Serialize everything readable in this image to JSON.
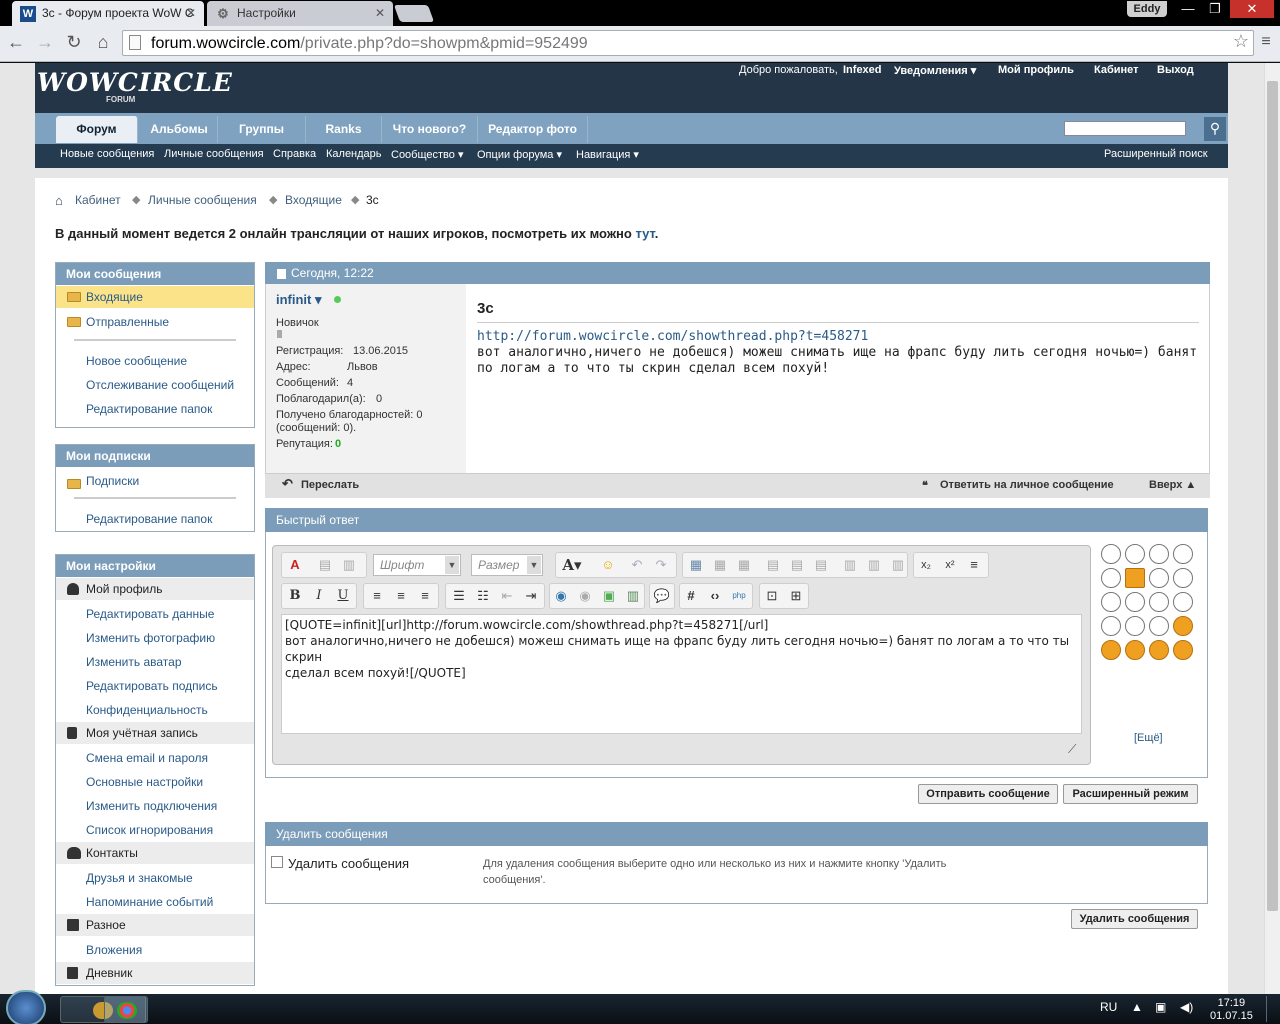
{
  "browser": {
    "tabs": [
      {
        "title": "3с - Форум проекта WoW C",
        "icon": "wowcircle-favicon"
      },
      {
        "title": "Настройки",
        "icon": "gear-icon"
      }
    ],
    "user": "Eddy",
    "url_host": "forum.wowcircle.com",
    "url_path": "/private.php?do=showpm&pmid=952499"
  },
  "site": {
    "logo": "WOWCIRCLE",
    "logo_sub": "FORUM",
    "top_links": [
      "Добро пожаловать,",
      "Infexed",
      "Уведомления",
      "Мой профиль",
      "Кабинет",
      "Выход"
    ],
    "tabs": [
      "Форум",
      "Альбомы",
      "Группы",
      "Ranks",
      "Что нового?",
      "Редактор фото"
    ],
    "subnav": [
      "Новые сообщения",
      "Личные сообщения",
      "Справка",
      "Календарь",
      "Сообщество",
      "Опции форума",
      "Навигация"
    ],
    "advanced_search": "Расширенный поиск"
  },
  "breadcrumb": [
    "Кабинет",
    "Личные сообщения",
    "Входящие",
    "3с"
  ],
  "notice": {
    "text": "В данный момент ведется 2 онлайн трансляции от наших игроков, посмотреть их можно ",
    "link": "тут",
    "end": "."
  },
  "sidebar": {
    "messages": {
      "title": "Мои сообщения",
      "folders": [
        "Входящие",
        "Отправленные"
      ],
      "links": [
        "Новое сообщение",
        "Отслеживание сообщений",
        "Редактирование папок"
      ]
    },
    "subscriptions": {
      "title": "Мои подписки",
      "folders": [
        "Подписки"
      ],
      "links": [
        "Редактирование папок"
      ]
    },
    "settings": {
      "title": "Мои настройки",
      "profile": "Мой профиль",
      "profile_links": [
        "Редактировать данные",
        "Изменить фотографию",
        "Изменить аватар",
        "Редактировать подпись",
        "Конфиденциальность"
      ],
      "account": "Моя учётная запись",
      "account_links": [
        "Смена email и пароля",
        "Основные настройки",
        "Изменить подключения",
        "Список игнорирования"
      ],
      "contacts": "Контакты",
      "contacts_links": [
        "Друзья и знакомые",
        "Напоминание событий"
      ],
      "misc": "Разное",
      "misc_links": [
        "Вложения"
      ],
      "diary": "Дневник"
    }
  },
  "pm": {
    "date": "Сегодня, 12:22",
    "author": "infinit",
    "rank": "Новичок",
    "registration_label": "Регистрация:",
    "registration": "13.06.2015",
    "address_label": "Адрес:",
    "address": "Львов",
    "posts_label": "Сообщений:",
    "posts": "4",
    "thanked_label": "Поблагодарил(а):",
    "thanked": "0",
    "thanks_received": "Получено благодарностей: 0",
    "thanks_received2": "(сообщений: 0).",
    "reputation_label": "Репутация:",
    "reputation": "0",
    "title": "3с",
    "link": "http://forum.wowcircle.com/showthread.php?t=458271",
    "text": "вот аналогично,ничего не добешся) можеш снимать ище на фрапс буду лить сегодня ночью=) банят по логам а то что ты скрин сделал всем похуй!",
    "forward": "Переслать",
    "reply": "Ответить на личное сообщение",
    "top": "Вверх"
  },
  "quick_reply": {
    "title": "Быстрый ответ",
    "font_placeholder": "Шрифт",
    "size_placeholder": "Размер",
    "text_line1": "[QUOTE=infinit][url]http://forum.wowcircle.com/showthread.php?t=458271[/url]",
    "text_line2": "вот аналогично,ничего не добешся) можеш снимать ище на фрапс буду лить сегодня ночью=) банят по логам а то что ты скрин",
    "text_line3": "сделал всем похуй![/QUOTE]",
    "more_smilies": "[Ещё]",
    "send": "Отправить сообщение",
    "advanced": "Расширенный режим"
  },
  "delete": {
    "title": "Удалить сообщения",
    "checkbox": "Удалить сообщения",
    "desc": "Для удаления сообщения выберите одно или несколько из них и нажмите кнопку 'Удалить сообщения'.",
    "button": "Удалить сообщения"
  },
  "taskbar": {
    "lang": "RU",
    "time": "17:19",
    "date": "01.07.15"
  }
}
